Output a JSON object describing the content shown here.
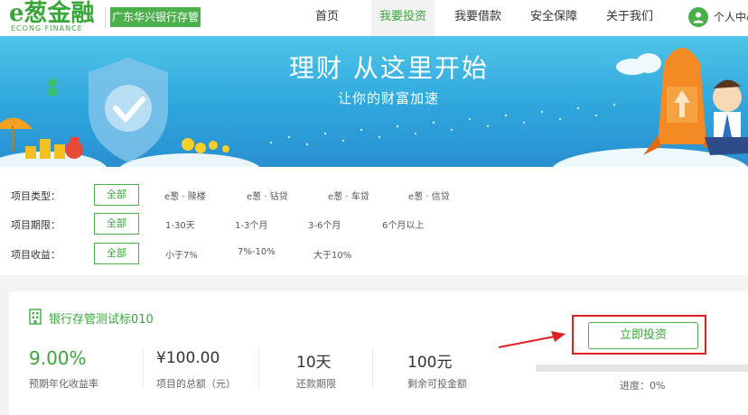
{
  "header": {
    "logo_text": "e葱金融",
    "logo_sub": "ECONG FINANCE",
    "bank_badge": "广东华兴银行存管",
    "nav": [
      "首页",
      "我要投资",
      "我要借款",
      "安全保障",
      "关于我们"
    ],
    "active_nav_index": 1,
    "user_link": "个人中心"
  },
  "banner": {
    "title": "理财 从这里开始",
    "subtitle": "让你的财富加速"
  },
  "filters": {
    "type": {
      "label": "项目类型：",
      "all": "全部",
      "options": [
        "e葱 · 赎楼",
        "e葱 · 钻贷",
        "e葱 · 车贷",
        "e葱 · 信贷"
      ]
    },
    "term": {
      "label": "项目期限：",
      "all": "全部",
      "options": [
        "1-30天",
        "1-3个月",
        "3-6个月",
        "6个月以上"
      ]
    },
    "yield": {
      "label": "项目收益：",
      "all": "全部",
      "options": [
        "小于7%",
        "7%-10%",
        "大于10%"
      ]
    }
  },
  "product": {
    "name": "银行存管测试标010",
    "rate": {
      "value": "9.00%",
      "label": "预期年化收益率"
    },
    "total": {
      "value": "¥100.00",
      "label": "项目的总额（元）"
    },
    "term": {
      "value": "10天",
      "label": "还款期限"
    },
    "remaining": {
      "value": "100元",
      "label": "剩余可投金额"
    },
    "invest_button": "立即投资",
    "progress": {
      "percent": 0,
      "label": "进度：0%"
    }
  },
  "colors": {
    "brand_green": "#3aa63a",
    "banner_blue": "#2ea6dc",
    "highlight_red": "#e02020"
  }
}
